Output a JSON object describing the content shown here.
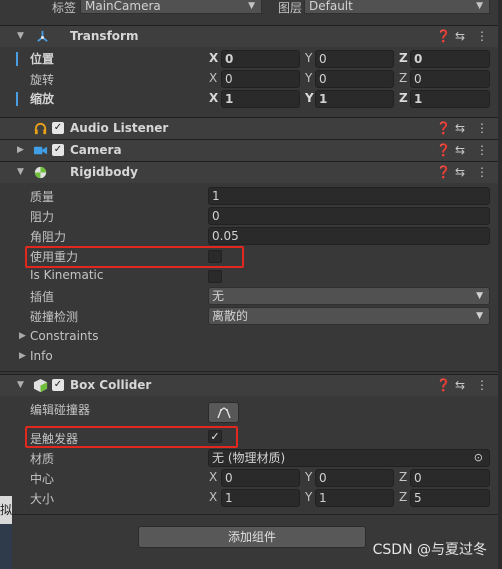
{
  "top": {
    "tag_label": "标签",
    "tag_value": "MainCamera",
    "layer_label": "图层",
    "layer_value": "Default"
  },
  "transform": {
    "title": "Transform",
    "rows": [
      {
        "label": "位置",
        "x": "0",
        "y": "0",
        "z": "0"
      },
      {
        "label": "旋转",
        "x": "0",
        "y": "0",
        "z": "0"
      },
      {
        "label": "缩放",
        "x": "1",
        "y": "1",
        "z": "1"
      }
    ]
  },
  "audio_listener": {
    "title": "Audio Listener"
  },
  "camera": {
    "title": "Camera"
  },
  "rigidbody": {
    "title": "Rigidbody",
    "mass_label": "质量",
    "mass": "1",
    "drag_label": "阻力",
    "drag": "0",
    "angular_drag_label": "角阻力",
    "angular_drag": "0.05",
    "use_gravity_label": "使用重力",
    "is_kinematic_label": "Is Kinematic",
    "interpolate_label": "插值",
    "interpolate": "无",
    "collision_label": "碰撞检测",
    "collision": "离散的",
    "constraints_label": "Constraints",
    "info_label": "Info"
  },
  "box_collider": {
    "title": "Box Collider",
    "edit_label": "编辑碰撞器",
    "trigger_label": "是触发器",
    "material_label": "材质",
    "material": "无 (物理材质)",
    "center_label": "中心",
    "center": {
      "x": "0",
      "y": "0",
      "z": "0"
    },
    "size_label": "大小",
    "size": {
      "x": "1",
      "y": "1",
      "z": "5"
    }
  },
  "axis": {
    "x": "X",
    "y": "Y",
    "z": "Z"
  },
  "add_component": "添加组件",
  "left_clip": "拟",
  "watermark": "CSDN @与夏过冬",
  "colors": {
    "highlight": "#e0281e",
    "transform_icon": "#4a9de0",
    "audio_icon": "#e8a01a",
    "camera_icon": "#3fa0e8",
    "rigidbody_icon": "#6fbf3a",
    "collider_icon": "#6fbf3a"
  }
}
